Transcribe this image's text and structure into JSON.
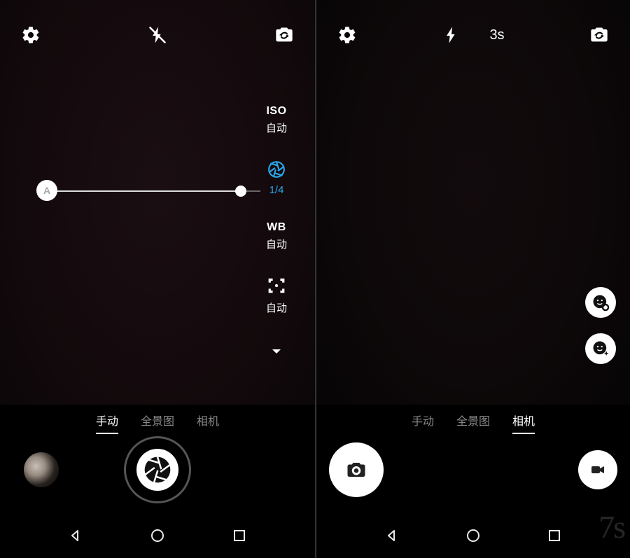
{
  "left": {
    "top": {
      "timer": ""
    },
    "manual": {
      "iso": {
        "label": "ISO",
        "value": "自动"
      },
      "shutter": {
        "value": "1/4"
      },
      "wb": {
        "label": "WB",
        "value": "自动"
      },
      "focus": {
        "value": "自动"
      }
    },
    "slider": {
      "a_label": "A"
    },
    "modes": {
      "m1": "手动",
      "m2": "全景图",
      "m3": "相机",
      "active": "m1"
    }
  },
  "right": {
    "top": {
      "timer": "3s"
    },
    "modes": {
      "m1": "手动",
      "m2": "全景图",
      "m3": "相机",
      "active": "m3"
    }
  },
  "watermark": "7s"
}
